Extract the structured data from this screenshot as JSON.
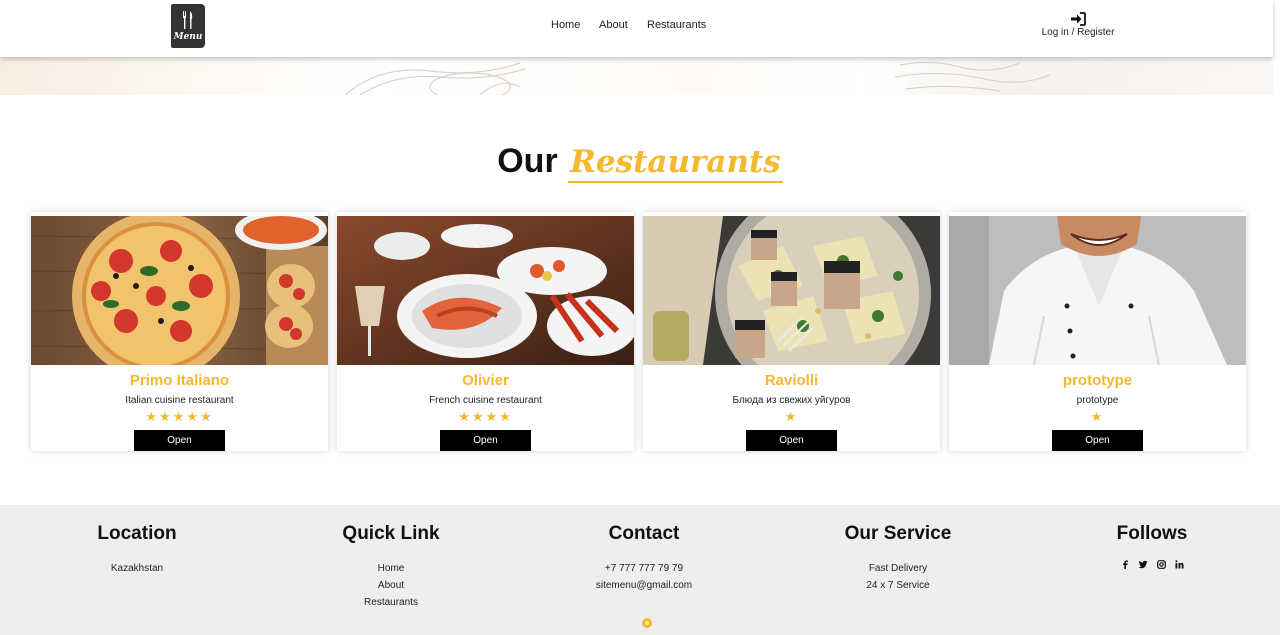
{
  "header": {
    "logo_text": "Menu",
    "nav": [
      {
        "label": "Home"
      },
      {
        "label": "About"
      },
      {
        "label": "Restaurants"
      }
    ],
    "login_label": "Log in / Register"
  },
  "section": {
    "title_plain": "Our",
    "title_accent": "Restaurants"
  },
  "cards": [
    {
      "name": "Primo Italiano",
      "desc": "Italian cuisine restaurant",
      "stars": "★★★★★",
      "button": "Open"
    },
    {
      "name": "Olivier",
      "desc": "French cuisine restaurant",
      "stars": "★★★★",
      "button": "Open"
    },
    {
      "name": "Raviolli",
      "desc": "Блюда из свежих уйгуров",
      "stars": "★",
      "button": "Open"
    },
    {
      "name": "prototype",
      "desc": "prototype",
      "stars": "★",
      "button": "Open"
    }
  ],
  "footer": {
    "location": {
      "title": "Location",
      "items": [
        "Kazakhstan"
      ]
    },
    "quick_link": {
      "title": "Quick Link",
      "items": [
        "Home",
        "About",
        "Restaurants"
      ]
    },
    "contact": {
      "title": "Contact",
      "items": [
        "+7 777 777 79 79",
        "sitemenu@gmail.com"
      ]
    },
    "service": {
      "title": "Our Service",
      "items": [
        "Fast Delivery",
        "24 x 7 Service"
      ]
    },
    "follows": {
      "title": "Follows",
      "social": [
        "f",
        "t",
        "ig",
        "in"
      ]
    }
  },
  "colors": {
    "accent": "#f5b82e",
    "button": "#000000",
    "footer_bg": "#eeeeee"
  }
}
